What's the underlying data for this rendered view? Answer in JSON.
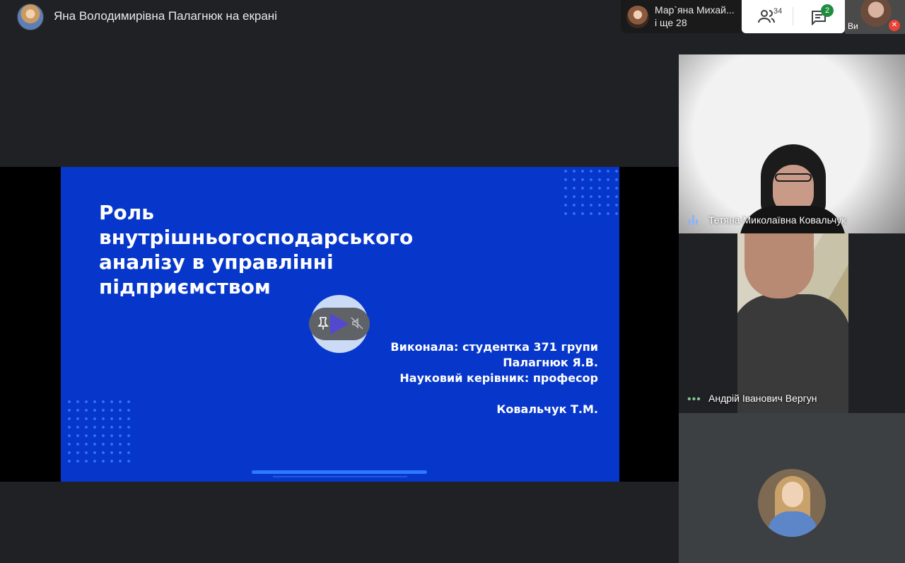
{
  "header": {
    "presenting_title": "Яна Володимирівна Палагнюк на екрані"
  },
  "participants_chip": {
    "name": "Мар`яна Михай...",
    "more": "і ще 28"
  },
  "controls": {
    "people_count": "34",
    "chat_badge": "2"
  },
  "self_view": {
    "name": "Ви"
  },
  "slide": {
    "title_lines": [
      "Роль",
      "внутрішньогосподарського",
      "аналізу в управлінні",
      "підприємством"
    ],
    "author_lines": [
      "Виконала: студентка 371 групи",
      "Палагнюк Я.В.",
      "Науковий керівник: професор",
      "Ковальчук Т.М."
    ]
  },
  "tiles": [
    {
      "name": "Тетяна Миколаївна Ковальчук",
      "status": "speaking"
    },
    {
      "name": "Андрій Іванович Вергун",
      "status": "more-options"
    },
    {
      "name": "",
      "status": "avatar-only"
    }
  ],
  "colors": {
    "background": "#202124",
    "slide_blue": "#0737ca",
    "accent_green": "#1e8e3e",
    "mic_off_red": "#ea4335"
  }
}
